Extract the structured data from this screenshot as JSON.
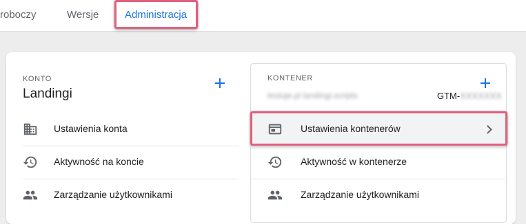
{
  "tabs": [
    {
      "label": "roboczy"
    },
    {
      "label": "Wersje"
    },
    {
      "label": "Administracja",
      "active": true
    }
  ],
  "account": {
    "section_label": "KONTO",
    "name": "Landingi",
    "add_icon": "plus-icon",
    "items": [
      {
        "label": "Ustawienia konta",
        "icon": "building-icon"
      },
      {
        "label": "Aktywność na koncie",
        "icon": "history-icon"
      },
      {
        "label": "Zarządzanie użytkownikami",
        "icon": "people-icon"
      }
    ]
  },
  "container": {
    "section_label": "KONTENER",
    "name_blurred": "testuje.pl landingi.scripts",
    "id_prefix": "GTM-",
    "id_blurred": "XXXXXXX",
    "add_icon": "plus-icon",
    "items": [
      {
        "label": "Ustawienia kontenerów",
        "icon": "window-icon",
        "selected": true
      },
      {
        "label": "Aktywność w kontenerze",
        "icon": "history-icon"
      },
      {
        "label": "Zarządzanie użytkownikami",
        "icon": "people-icon"
      }
    ]
  },
  "colors": {
    "accent": "#1a73e8",
    "highlight": "#e0607e",
    "icon": "#5f6368"
  }
}
